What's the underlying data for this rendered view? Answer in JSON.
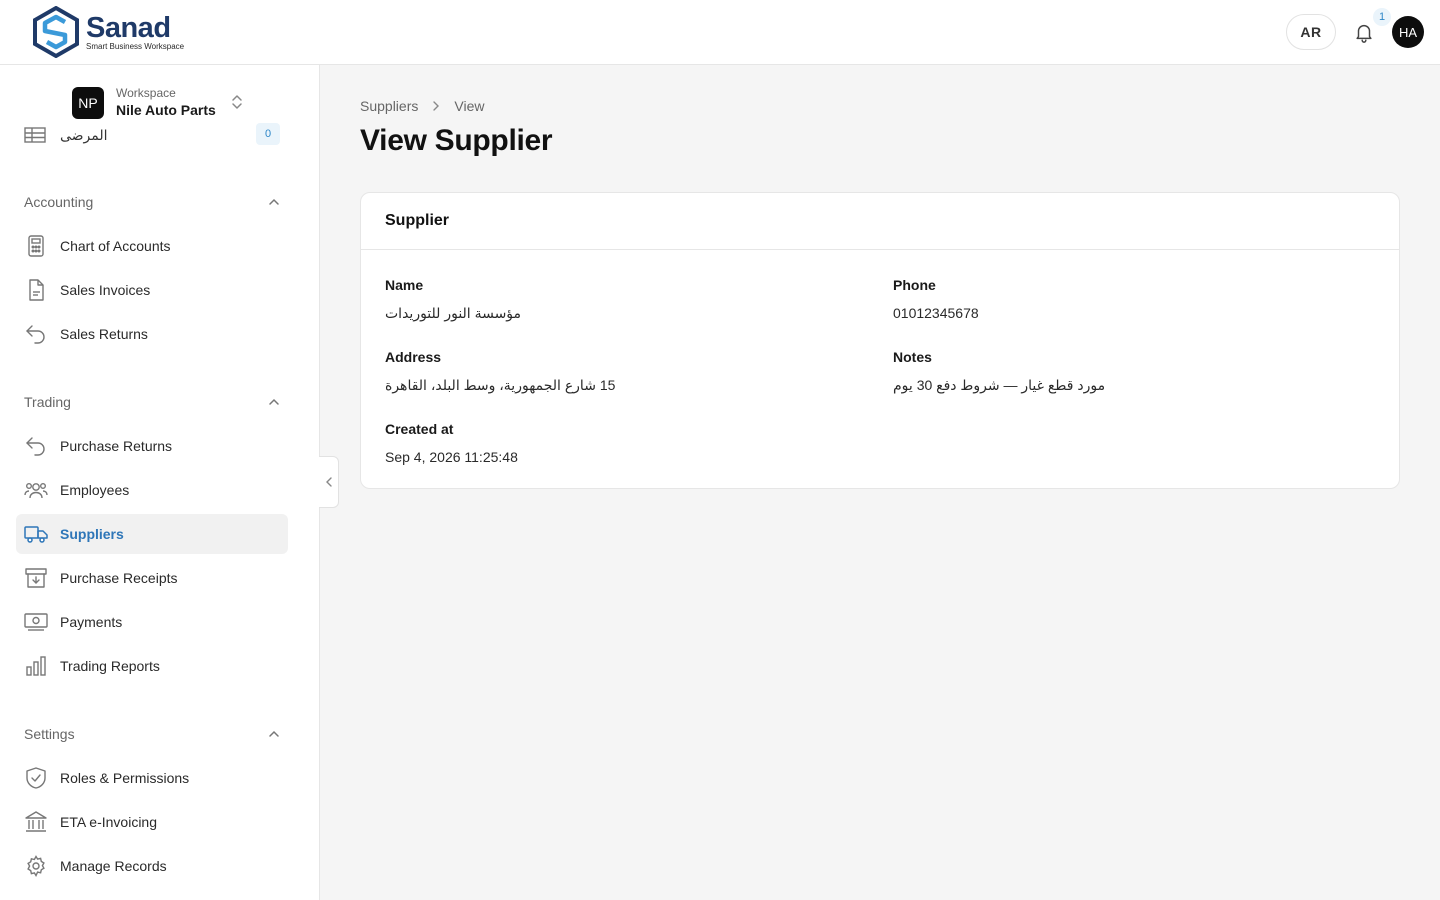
{
  "brand": {
    "name": "Sanad",
    "tagline": "Smart Business Workspace"
  },
  "header": {
    "lang_label": "AR",
    "notification_count": "1",
    "avatar_initials": "HA"
  },
  "workspace": {
    "initials": "NP",
    "label": "Workspace",
    "name": "Nile Auto Parts",
    "peek_label": "المرضى",
    "peek_count": "0"
  },
  "sidebar": {
    "sections": [
      {
        "title": "Accounting",
        "items": [
          {
            "label": "Chart of Accounts",
            "icon": "calculator-icon"
          },
          {
            "label": "Sales Invoices",
            "icon": "document-icon"
          },
          {
            "label": "Sales Returns",
            "icon": "return-arrow-icon"
          }
        ]
      },
      {
        "title": "Trading",
        "items": [
          {
            "label": "Purchase Returns",
            "icon": "return-arrow-icon"
          },
          {
            "label": "Employees",
            "icon": "users-icon"
          },
          {
            "label": "Suppliers",
            "icon": "truck-icon",
            "active": true
          },
          {
            "label": "Purchase Receipts",
            "icon": "archive-icon"
          },
          {
            "label": "Payments",
            "icon": "cash-icon"
          },
          {
            "label": "Trading Reports",
            "icon": "bar-chart-icon"
          }
        ]
      },
      {
        "title": "Settings",
        "items": [
          {
            "label": "Roles & Permissions",
            "icon": "shield-check-icon"
          },
          {
            "label": "ETA e-Invoicing",
            "icon": "bank-icon"
          },
          {
            "label": "Manage Records",
            "icon": "gear-icon"
          }
        ]
      }
    ]
  },
  "breadcrumb": {
    "parent": "Suppliers",
    "current": "View"
  },
  "page": {
    "title": "View Supplier"
  },
  "card": {
    "title": "Supplier",
    "fields": {
      "name": {
        "label": "Name",
        "value": "مؤسسة النور للتوريدات"
      },
      "phone": {
        "label": "Phone",
        "value": "01012345678"
      },
      "address": {
        "label": "Address",
        "value": "15 شارع الجمهورية، وسط البلد، القاهرة"
      },
      "notes": {
        "label": "Notes",
        "value": "مورد قطع غيار — شروط دفع 30 يوم"
      },
      "created_at": {
        "label": "Created at",
        "value": "Sep 4, 2026 11:25:48"
      }
    }
  },
  "colors": {
    "accent": "#2e76b8",
    "brand_dark": "#1f3a68",
    "brand_light": "#3b9ad9",
    "badge_bg": "#eaf4fb"
  }
}
